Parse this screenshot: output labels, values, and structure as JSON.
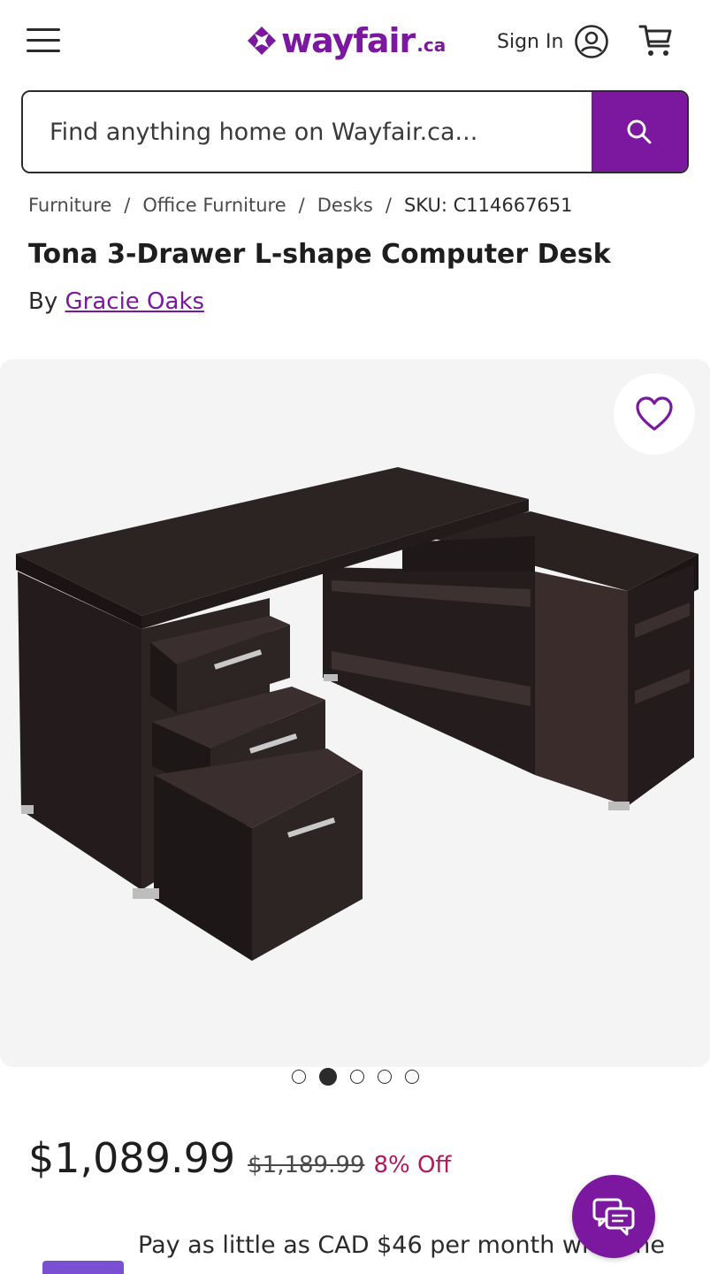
{
  "header": {
    "logo_text": "wayfair",
    "logo_suffix": ".ca",
    "signin_label": "Sign In"
  },
  "search": {
    "placeholder": "Find anything home on Wayfair.ca..."
  },
  "breadcrumb": {
    "items": [
      "Furniture",
      "Office Furniture",
      "Desks"
    ],
    "separator": "/",
    "sku": "SKU: C114667651"
  },
  "product": {
    "title": "Tona 3-Drawer L-shape Computer Desk",
    "by_prefix": "By",
    "brand": "Gracie Oaks"
  },
  "gallery": {
    "total_images": 5,
    "active_index": 1
  },
  "pricing": {
    "price": "$1,089.99",
    "old_price": "$1,189.99",
    "discount": "8% Off"
  },
  "financing": {
    "text": "Pay as little as CAD $46 per month with one"
  },
  "colors": {
    "brand_purple": "#7b189f",
    "discount_red": "#b0185f",
    "desk_dark": "#2a1f1f"
  },
  "icons": {
    "menu": "hamburger-icon",
    "account": "account-circle-icon",
    "cart": "cart-icon",
    "search": "search-icon",
    "favorite": "heart-icon",
    "chat": "chat-icon"
  }
}
